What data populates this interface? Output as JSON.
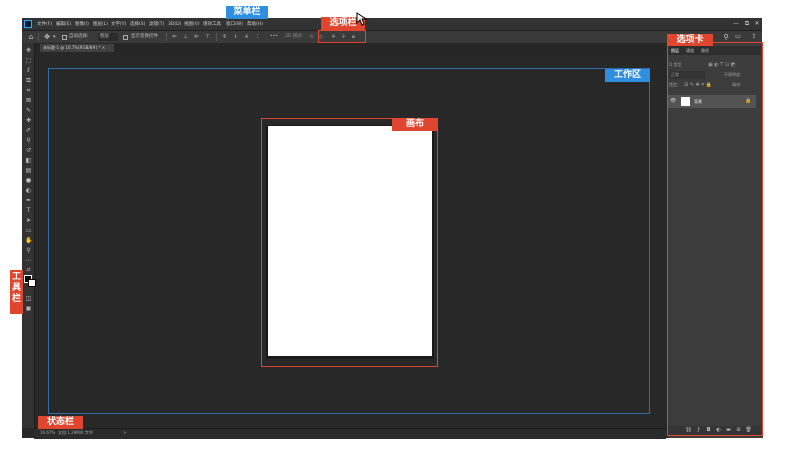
{
  "menubar": {
    "items": [
      "文件(F)",
      "编辑(E)",
      "图像(I)",
      "图层(L)",
      "文字(Y)",
      "选择(S)",
      "滤镜(T)",
      "3D(D)",
      "视图(V)",
      "增效工具",
      "窗口(W)",
      "帮助(H)"
    ],
    "window_controls": [
      "—",
      "⧉",
      "✕"
    ]
  },
  "optionsbar": {
    "auto_select_label": "自动选择:",
    "auto_select_value": "图层",
    "show_transform_label": "显示变换控件",
    "more_label": "•••",
    "mode_3d_label": "3D 模式:"
  },
  "document": {
    "tab_label": "未标题-1 @ 16.7%(RGB/8#) *",
    "close_icon": "×"
  },
  "statusbar": {
    "zoom": "16.67%",
    "doc_info": "文档:1.29M/0 字节",
    "arrow": ">"
  },
  "panel": {
    "tabs": [
      "图层",
      "通道",
      "路径"
    ],
    "search_placeholder": "Q 类型",
    "blend_mode": "正常",
    "opacity_label": "不透明度:",
    "lock_label": "锁定:",
    "fill_label": "填充:",
    "layer_name": "背景"
  },
  "annotations": {
    "menubar": "菜单栏",
    "optionsbar": "选项栏",
    "panel_tab": "选项卡",
    "workarea": "工作区",
    "canvas": "画布",
    "toolbar": "工具栏",
    "statusbar": "状态栏"
  },
  "tools": [
    "move-icon",
    "marquee-icon",
    "lasso-icon",
    "object-select-icon",
    "crop-icon",
    "frame-icon",
    "eyedropper-icon",
    "healing-icon",
    "brush-icon",
    "stamp-icon",
    "history-brush-icon",
    "eraser-icon",
    "gradient-icon",
    "blur-icon",
    "dodge-icon",
    "pen-icon",
    "type-icon",
    "path-select-icon",
    "shape-icon",
    "hand-icon",
    "zoom-icon",
    "more-tools-icon",
    "swap-colors-icon",
    "foreground-color-icon",
    "quick-mask-icon",
    "screen-mode-icon"
  ],
  "colors": {
    "accent_blue": "#2f8ee0",
    "accent_red": "#e0462f"
  }
}
